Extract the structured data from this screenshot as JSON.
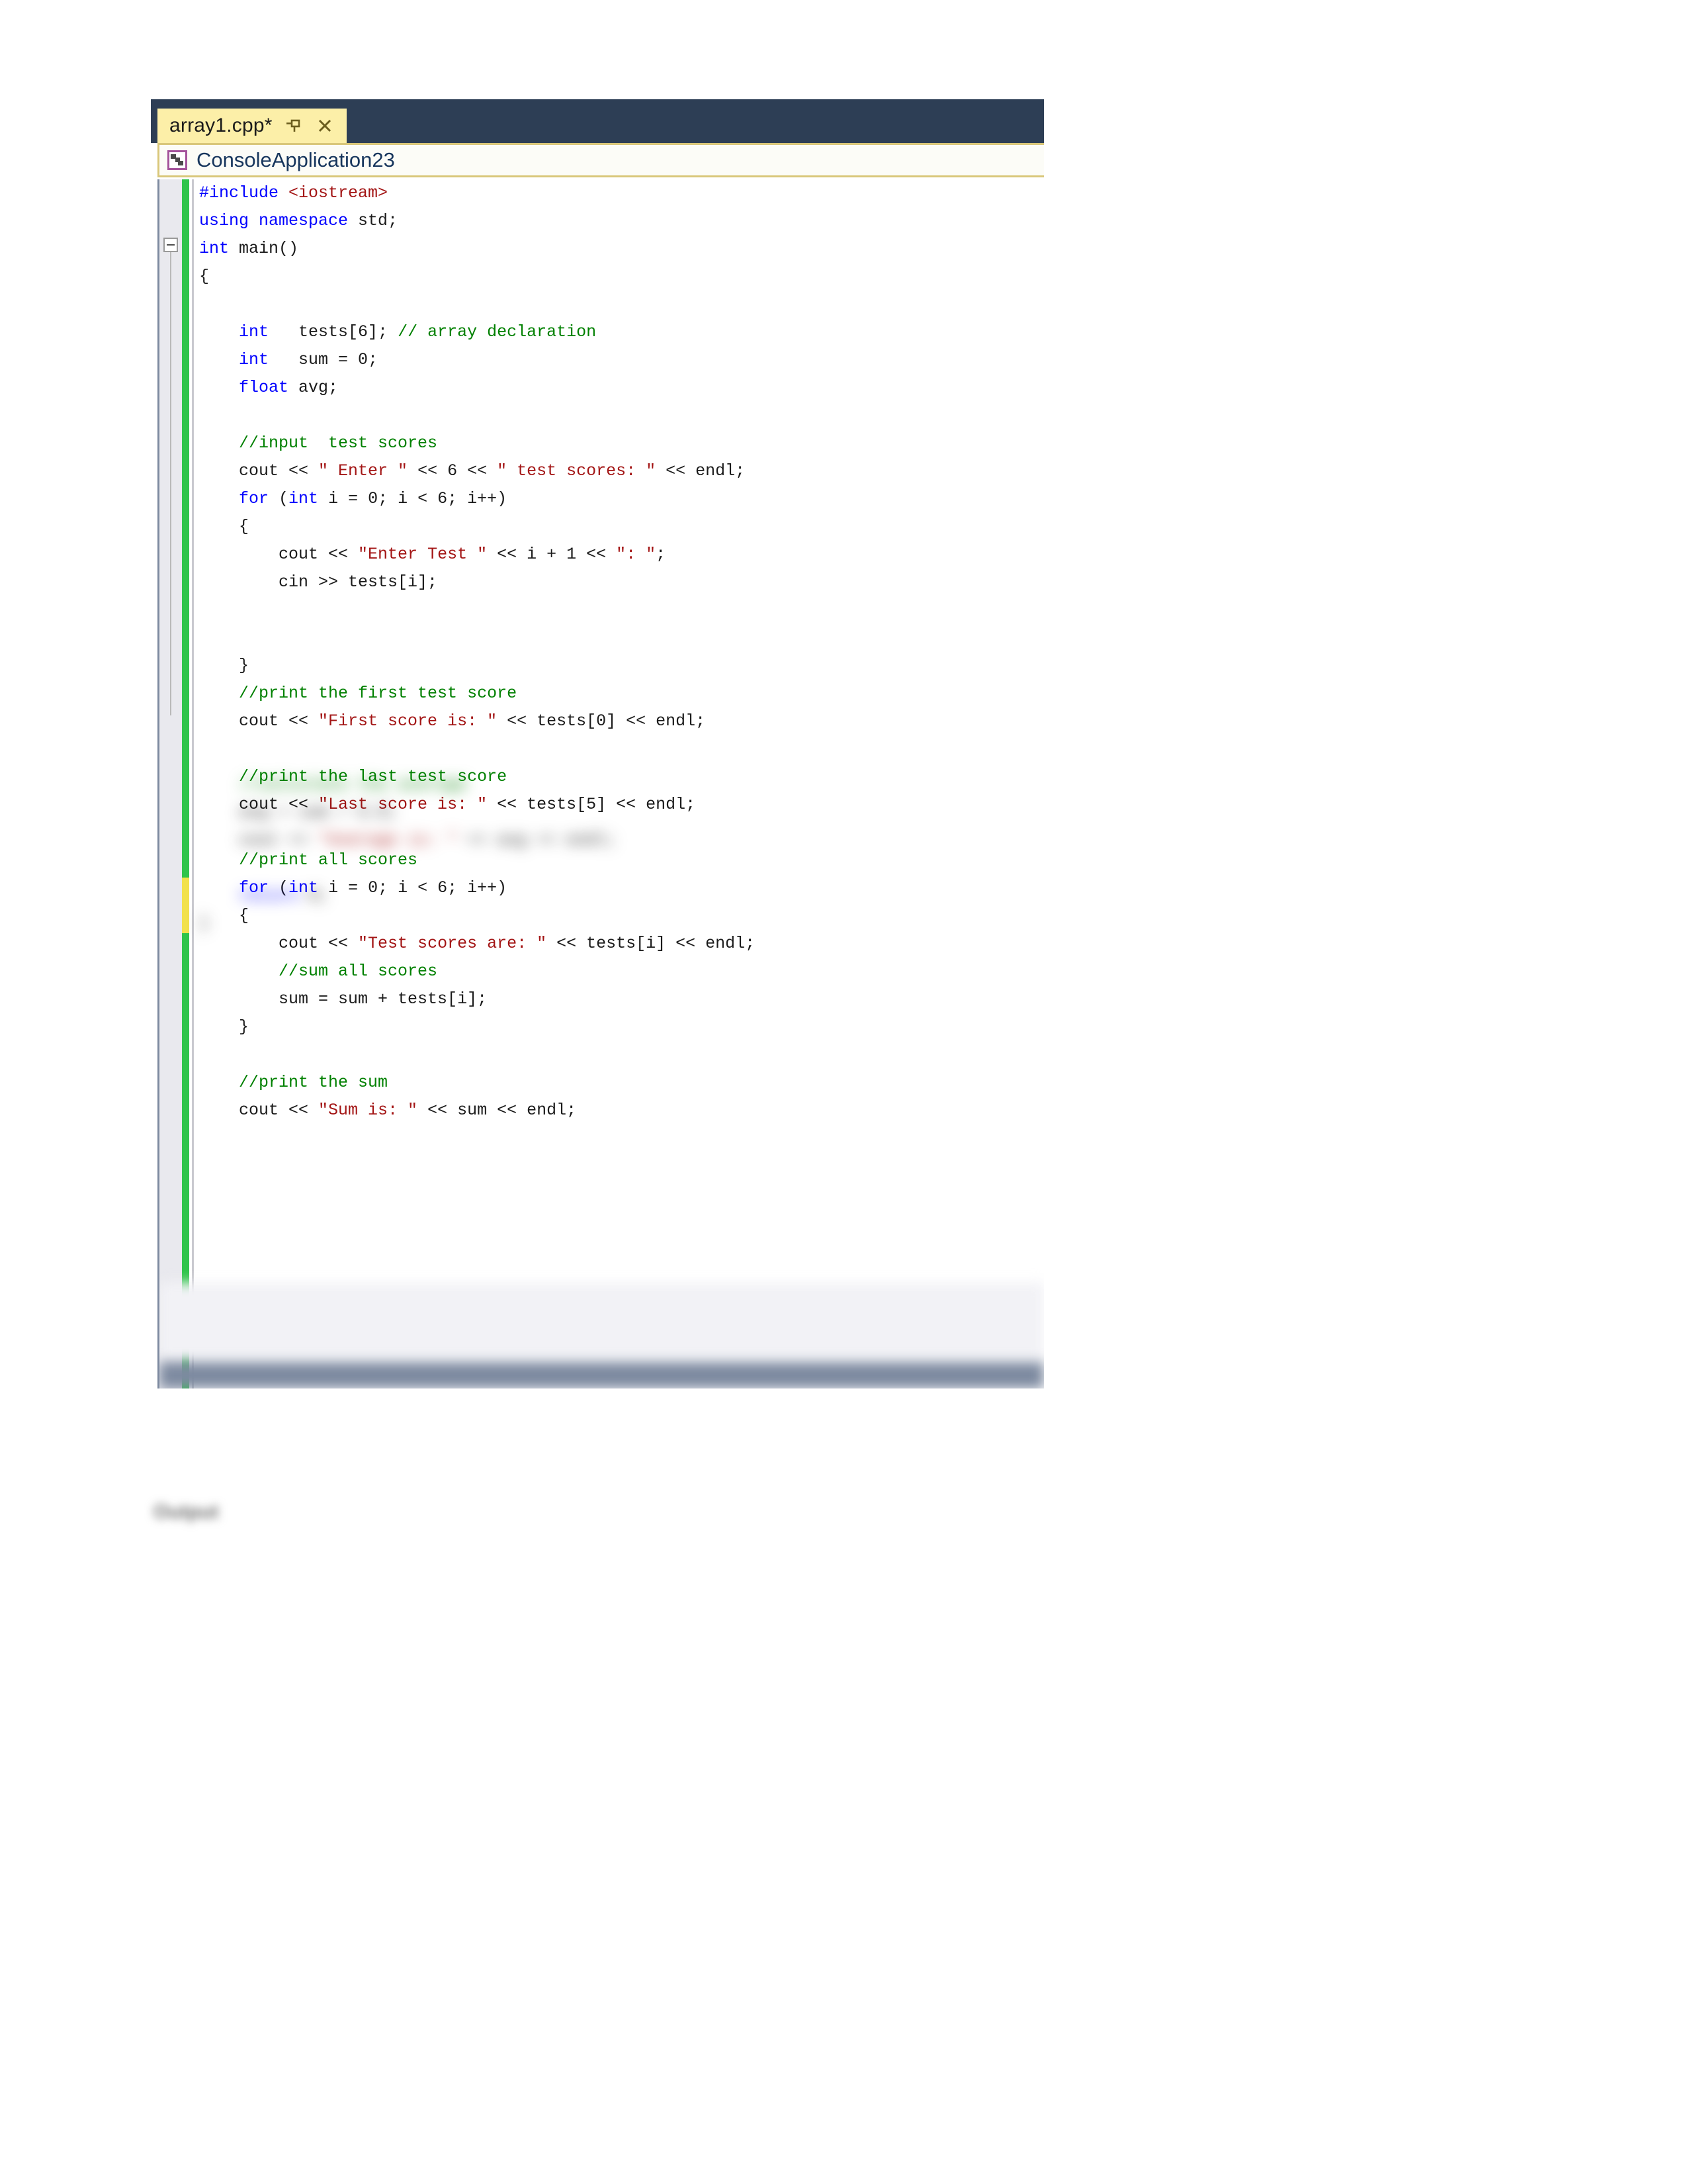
{
  "document": {
    "background_color": "#ffffff",
    "caption_below_window": "Output"
  },
  "editor": {
    "theme_colors": {
      "tabstrip_background": "#2d3e55",
      "active_tab_background": "#fcefa8",
      "navbar_background": "#fcfcf7",
      "navbar_border": "#d9c77a",
      "gutter_background": "#e9e9ee",
      "change_bar_saved": "#2fc44b",
      "change_bar_unsaved": "#f2e14c",
      "keyword": "#0000ff",
      "string": "#a31515",
      "comment": "#008000",
      "plain_text": "#1b1b1b",
      "status_bar": "#7d8aa0"
    },
    "tab": {
      "label": "array1.cpp*",
      "pin_icon": "pin-icon",
      "close_icon": "close-icon"
    },
    "navbar": {
      "project_icon": "project-icon",
      "label": "ConsoleApplication23"
    },
    "code_lines": [
      [
        {
          "t": "#include ",
          "c": "pp"
        },
        {
          "t": "<iostream>",
          "c": "inc"
        }
      ],
      [
        {
          "t": "using namespace ",
          "c": "k"
        },
        {
          "t": "std;",
          "c": "t"
        }
      ],
      [
        {
          "t": "int ",
          "c": "k"
        },
        {
          "t": "main()",
          "c": "t"
        }
      ],
      [
        {
          "t": "{",
          "c": "t"
        }
      ],
      [],
      [
        {
          "t": "    int   ",
          "c": "k"
        },
        {
          "t": "tests[6]; ",
          "c": "t"
        },
        {
          "t": "// array declaration",
          "c": "c"
        }
      ],
      [
        {
          "t": "    int   ",
          "c": "k"
        },
        {
          "t": "sum = 0;",
          "c": "t"
        }
      ],
      [
        {
          "t": "    float ",
          "c": "k"
        },
        {
          "t": "avg;",
          "c": "t"
        }
      ],
      [],
      [
        {
          "t": "    //input  test scores",
          "c": "c"
        }
      ],
      [
        {
          "t": "    cout << ",
          "c": "t"
        },
        {
          "t": "\" Enter \"",
          "c": "s"
        },
        {
          "t": " << 6 << ",
          "c": "t"
        },
        {
          "t": "\" test scores: \"",
          "c": "s"
        },
        {
          "t": " << endl;",
          "c": "t"
        }
      ],
      [
        {
          "t": "    for ",
          "c": "k"
        },
        {
          "t": "(",
          "c": "t"
        },
        {
          "t": "int ",
          "c": "k"
        },
        {
          "t": "i = 0; i < 6; i++)",
          "c": "t"
        }
      ],
      [
        {
          "t": "    {",
          "c": "t"
        }
      ],
      [
        {
          "t": "        cout << ",
          "c": "t"
        },
        {
          "t": "\"Enter Test \"",
          "c": "s"
        },
        {
          "t": " << i + 1 << ",
          "c": "t"
        },
        {
          "t": "\": \"",
          "c": "s"
        },
        {
          "t": ";",
          "c": "t"
        }
      ],
      [
        {
          "t": "        cin >> tests[i];",
          "c": "t"
        }
      ],
      [],
      [],
      [
        {
          "t": "    }",
          "c": "t"
        }
      ],
      [
        {
          "t": "    //print the first test score",
          "c": "c"
        }
      ],
      [
        {
          "t": "    cout << ",
          "c": "t"
        },
        {
          "t": "\"First score is: \"",
          "c": "s"
        },
        {
          "t": " << tests[0] << endl;",
          "c": "t"
        }
      ],
      [],
      [
        {
          "t": "    //print the last test score",
          "c": "c"
        }
      ],
      [
        {
          "t": "    cout << ",
          "c": "t"
        },
        {
          "t": "\"Last score is: \"",
          "c": "s"
        },
        {
          "t": " << tests[5] << endl;",
          "c": "t"
        }
      ],
      [],
      [
        {
          "t": "    //print all scores",
          "c": "c"
        }
      ],
      [
        {
          "t": "    for ",
          "c": "k"
        },
        {
          "t": "(",
          "c": "t"
        },
        {
          "t": "int ",
          "c": "k"
        },
        {
          "t": "i = 0; i < 6; i++)",
          "c": "t"
        }
      ],
      [
        {
          "t": "    {",
          "c": "t"
        }
      ],
      [
        {
          "t": "        cout << ",
          "c": "t"
        },
        {
          "t": "\"Test scores are: \"",
          "c": "s"
        },
        {
          "t": " << tests[i] << endl;",
          "c": "t"
        }
      ],
      [
        {
          "t": "        //sum all scores",
          "c": "c"
        }
      ],
      [
        {
          "t": "        sum = sum + tests[i];",
          "c": "t"
        }
      ],
      [
        {
          "t": "    }",
          "c": "t"
        }
      ],
      [],
      [
        {
          "t": "    //print the sum",
          "c": "c"
        }
      ],
      [
        {
          "t": "    cout << ",
          "c": "t"
        },
        {
          "t": "\"Sum is: \"",
          "c": "s"
        },
        {
          "t": " << sum << endl;",
          "c": "t"
        }
      ]
    ],
    "obscured_region": {
      "note": "Lower portion of the editor is blurred and unreadable.",
      "blurred_lines": [
        [
          {
            "t": "    //calculate the average",
            "c": "c"
          }
        ],
        [
          {
            "t": "    avg = sum / 6.0;",
            "c": "t"
          }
        ],
        [
          {
            "t": "    cout << ",
            "c": "t"
          },
          {
            "t": "\"Average is: \"",
            "c": "s"
          },
          {
            "t": " << avg << endl;",
            "c": "t"
          }
        ],
        [],
        [
          {
            "t": "    return ",
            "c": "k"
          },
          {
            "t": "0;",
            "c": "t"
          }
        ],
        [
          {
            "t": "}",
            "c": "t"
          }
        ]
      ]
    }
  }
}
